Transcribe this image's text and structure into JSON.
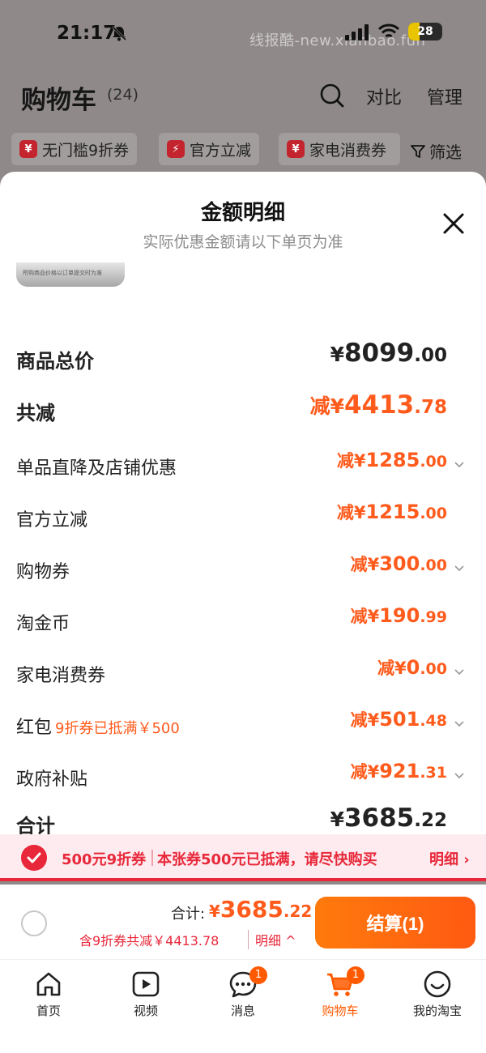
{
  "status_bar": {
    "time": "21:17",
    "battery": "28",
    "watermark": "线报酷-new.xianbao.fun"
  },
  "header": {
    "title": "购物车",
    "count": "(24)",
    "compare": "对比",
    "manage": "管理"
  },
  "coupon_strip": {
    "chips": [
      {
        "label": "无门槛9折券",
        "icon": "yen-coupon-icon"
      },
      {
        "label": "官方立减",
        "icon": "lightning-icon"
      },
      {
        "label": "家电消费券",
        "icon": "yen-coupon-icon"
      }
    ],
    "filter": "筛选"
  },
  "sheet": {
    "title": "金额明细",
    "subtitle": "实际优惠金额请以下单页为准",
    "thumb_text": "所购商品价格以订单提交时为准",
    "rows": [
      {
        "label": "商品总价",
        "prefix": "¥",
        "int": "8099",
        "dec": ".00"
      },
      {
        "label": "共减",
        "prefix": "减¥",
        "int": "4413",
        "dec": ".78"
      },
      {
        "label": "单品直降及店铺优惠",
        "prefix": "减¥",
        "int": "1285",
        "dec": ".00"
      },
      {
        "label": "官方立减",
        "prefix": "减¥",
        "int": "1215",
        "dec": ".00"
      },
      {
        "label": "购物券",
        "prefix": "减¥",
        "int": "300",
        "dec": ".00"
      },
      {
        "label": "淘金币",
        "prefix": "减¥",
        "int": "190",
        "dec": ".99"
      },
      {
        "label": "家电消费券",
        "prefix": "减¥",
        "int": "0",
        "dec": ".00"
      },
      {
        "label": "红包",
        "note": "9折券已抵满￥500",
        "prefix": "减¥",
        "int": "501",
        "dec": ".48"
      },
      {
        "label": "政府补贴",
        "prefix": "减¥",
        "int": "921",
        "dec": ".31"
      },
      {
        "label": "合计",
        "prefix": "¥",
        "int": "3685",
        "dec": ".22"
      }
    ]
  },
  "notice": {
    "coupon_name": "500元9折券",
    "message": "本张券500元已抵满，请尽快购买",
    "detail": "明细 ›"
  },
  "checkout": {
    "total_label": "合计:",
    "total_prefix": "¥",
    "total_int": "3685",
    "total_dec": ".22",
    "savings": "含9折券共减￥4413.78",
    "savings_detail": "明细 ^",
    "button": "结算(1)"
  },
  "tabbar": {
    "tabs": [
      {
        "label": "首页",
        "icon": "home-icon"
      },
      {
        "label": "视频",
        "icon": "video-icon"
      },
      {
        "label": "消息",
        "icon": "message-icon",
        "badge": "1"
      },
      {
        "label": "购物车",
        "icon": "cart-icon",
        "badge": "1",
        "active": true
      },
      {
        "label": "我的淘宝",
        "icon": "profile-icon"
      }
    ]
  },
  "colors": {
    "accent_orange": "#ff5b1c",
    "accent_red": "#e8283a"
  }
}
